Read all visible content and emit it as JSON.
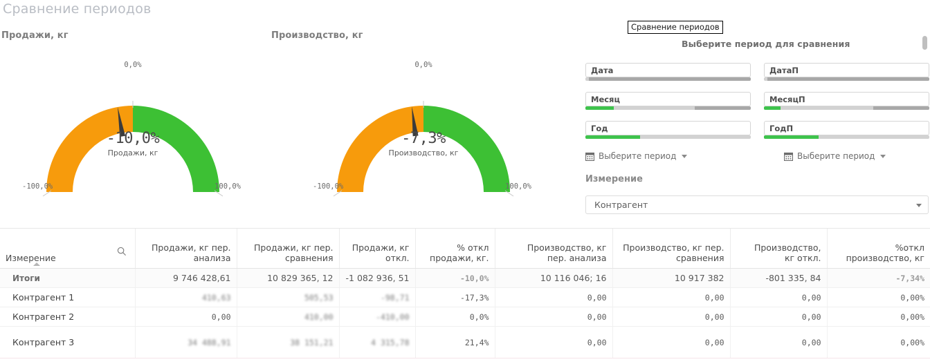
{
  "app": {
    "title": "Сравнение периодов"
  },
  "gauges": [
    {
      "panel_title": "Продажи, кг",
      "center_value": "-10,0%",
      "center_label": "Продажи, кг",
      "tick_top": "0,0%",
      "tick_min": "-100,0%",
      "tick_max": "100,0%",
      "value": -10.0,
      "min": -100.0,
      "max": 100.0,
      "color_negative": "#F79B0C",
      "color_positive": "#3DC034"
    },
    {
      "panel_title": "Производство, кг",
      "center_value": "-7,3%",
      "center_label": "Производство, кг",
      "tick_top": "0,0%",
      "tick_min": "-100,0%",
      "tick_max": "100,0%",
      "value": -7.3,
      "min": -100.0,
      "max": 100.0,
      "color_negative": "#F79B0C",
      "color_positive": "#3DC034"
    }
  ],
  "controls": {
    "tooltip": "Сравнение периодов",
    "heading": "Выберите период для сравнения",
    "filters": [
      {
        "label": "Дата",
        "sel_pct": 0,
        "dark_start_pct": 2,
        "dark_end_pct": 100
      },
      {
        "label": "ДатаП",
        "sel_pct": 0,
        "dark_start_pct": 2,
        "dark_end_pct": 100
      },
      {
        "label": "Месяц",
        "sel_pct": 17,
        "dark_start_pct": 66,
        "dark_end_pct": 100
      },
      {
        "label": "МесяцП",
        "sel_pct": 10,
        "dark_start_pct": 66,
        "dark_end_pct": 100
      },
      {
        "label": "Год",
        "sel_pct": 33,
        "dark_start_pct": 100,
        "dark_end_pct": 100
      },
      {
        "label": "ГодП",
        "sel_pct": 33,
        "dark_start_pct": 100,
        "dark_end_pct": 100
      }
    ],
    "period_picker_left": "Выберите период",
    "period_picker_right": "Выберите период",
    "measure_label": "Измерение",
    "measure_value": "Контрагент"
  },
  "table": {
    "columns": [
      "Измерение",
      "Продажи, кг пер. анализа",
      "Продажи, кг пер. сравнения",
      "Продажи, кг откл.",
      "% откл продажи, кг.",
      "Производство, кг пер. анализа",
      "Производство, кг пер. сравнения",
      "Производство, кг откл.",
      "%откл производство, кг"
    ],
    "columns_split": [
      [
        "Измерение",
        ""
      ],
      [
        "Продажи, кг пер.",
        "анализа"
      ],
      [
        "Продажи, кг пер.",
        "сравнения"
      ],
      [
        "Продажи, кг",
        "откл."
      ],
      [
        "% откл",
        "продажи, кг."
      ],
      [
        "Производство, кг",
        "пер. анализа"
      ],
      [
        "Производство, кг пер.",
        "сравнения"
      ],
      [
        "Производство,",
        "кг откл."
      ],
      [
        "%откл",
        "производство, кг"
      ]
    ],
    "totals_label": "Итоги",
    "totals": [
      "9 746 428,61",
      "10 829 365, 12",
      "-1 082 936, 51",
      "-10,0%",
      "10 116 046; 16",
      "10 917 382",
      "-801 335, 84",
      "-7,34%"
    ],
    "rows": [
      {
        "name": "Контрагент 1",
        "cells": [
          "410,63",
          "505,53",
          "-98,71",
          "-17,3%",
          "0,00",
          "0,00",
          "0,00",
          "0,00%"
        ],
        "blurred": [
          true,
          true,
          true,
          false,
          false,
          false,
          false,
          false
        ]
      },
      {
        "name": "Контрагент 2",
        "cells": [
          "0,00",
          "410,00",
          "-410,00",
          "0,0%",
          "0,00",
          "0,00",
          "0,00",
          "0,00%"
        ],
        "blurred": [
          false,
          true,
          true,
          false,
          false,
          false,
          false,
          false
        ]
      },
      {
        "name": "Контрагент 3",
        "cells": [
          "34 488,91",
          "38 151,21",
          "4 315,78",
          "21,4%",
          "0,00",
          "0,00",
          "0,00",
          "0,00%"
        ],
        "blurred": [
          true,
          true,
          true,
          false,
          false,
          false,
          false,
          false
        ]
      }
    ]
  },
  "icons": {
    "search": "search-icon",
    "calendar": "calendar-icon",
    "sort_asc": "sort-ascending-icon",
    "dropdown": "chevron-down-icon"
  }
}
